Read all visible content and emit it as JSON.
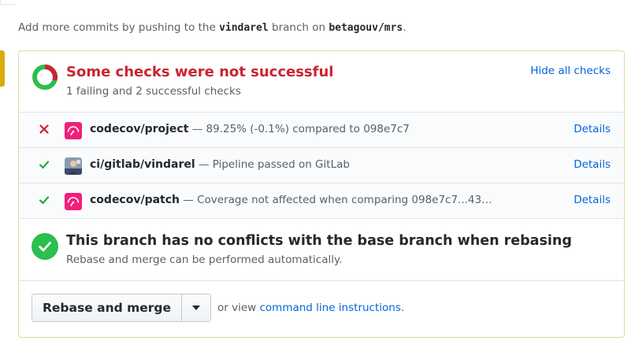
{
  "hint": {
    "prefix": "Add more commits by pushing to the ",
    "branch": "vindarel",
    "middle": " branch on ",
    "repo": "betagouv/mrs",
    "suffix": "."
  },
  "status": {
    "title": "Some checks were not successful",
    "subtitle": "1 failing and 2 successful checks",
    "hide_label": "Hide all checks",
    "fail_color": "#cb2431",
    "success_color": "#2cbe4e"
  },
  "checks": [
    {
      "state": "failure",
      "icon": "codecov-icon",
      "name": "codecov/project",
      "description": " — 89.25% (-0.1%) compared to 098e7c7",
      "details_label": "Details"
    },
    {
      "state": "success",
      "icon": "gitlab-avatar",
      "name": "ci/gitlab/vindarel",
      "description": " — Pipeline passed on GitLab",
      "details_label": "Details"
    },
    {
      "state": "success",
      "icon": "codecov-icon",
      "name": "codecov/patch",
      "description": " — Coverage not affected when comparing 098e7c7...43…",
      "details_label": "Details"
    }
  ],
  "merge": {
    "title": "This branch has no conflicts with the base branch when rebasing",
    "subtitle": "Rebase and merge can be performed automatically.",
    "button_label": "Rebase and merge",
    "alt_prefix": "or view ",
    "alt_link": "command line instructions",
    "alt_suffix": "."
  }
}
